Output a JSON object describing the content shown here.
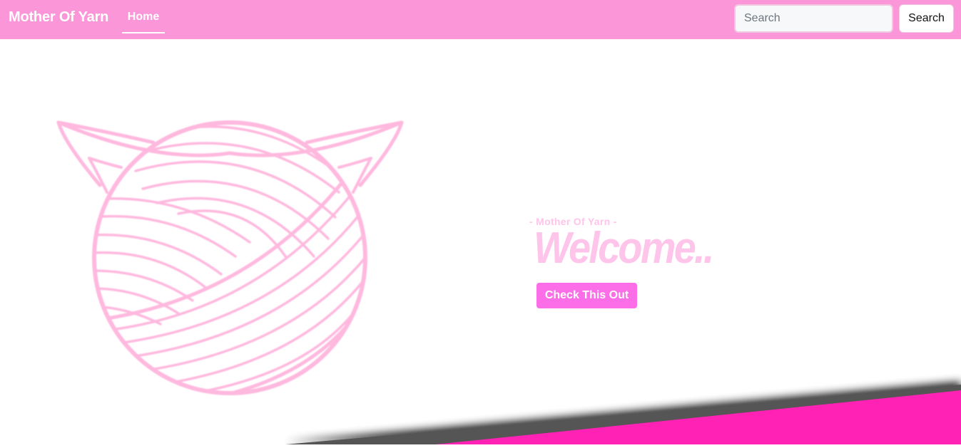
{
  "navbar": {
    "brand": "Mother Of Yarn",
    "links": [
      {
        "label": "Home",
        "active": true
      }
    ],
    "search": {
      "placeholder": "Search",
      "value": "",
      "button_label": "Search"
    }
  },
  "hero": {
    "tagline": "- Mother Of Yarn -",
    "headline": "Welcome..",
    "cta_label": "Check This Out"
  },
  "logo": {
    "icon": "yarn-ball-cat-icon"
  },
  "colors": {
    "navbar_bg": "#fb96d8",
    "accent": "#fb6ee8",
    "logo_stroke": "#ffb8de",
    "headline": "#ffc4ea",
    "bottom_band": "#ff22b4"
  }
}
